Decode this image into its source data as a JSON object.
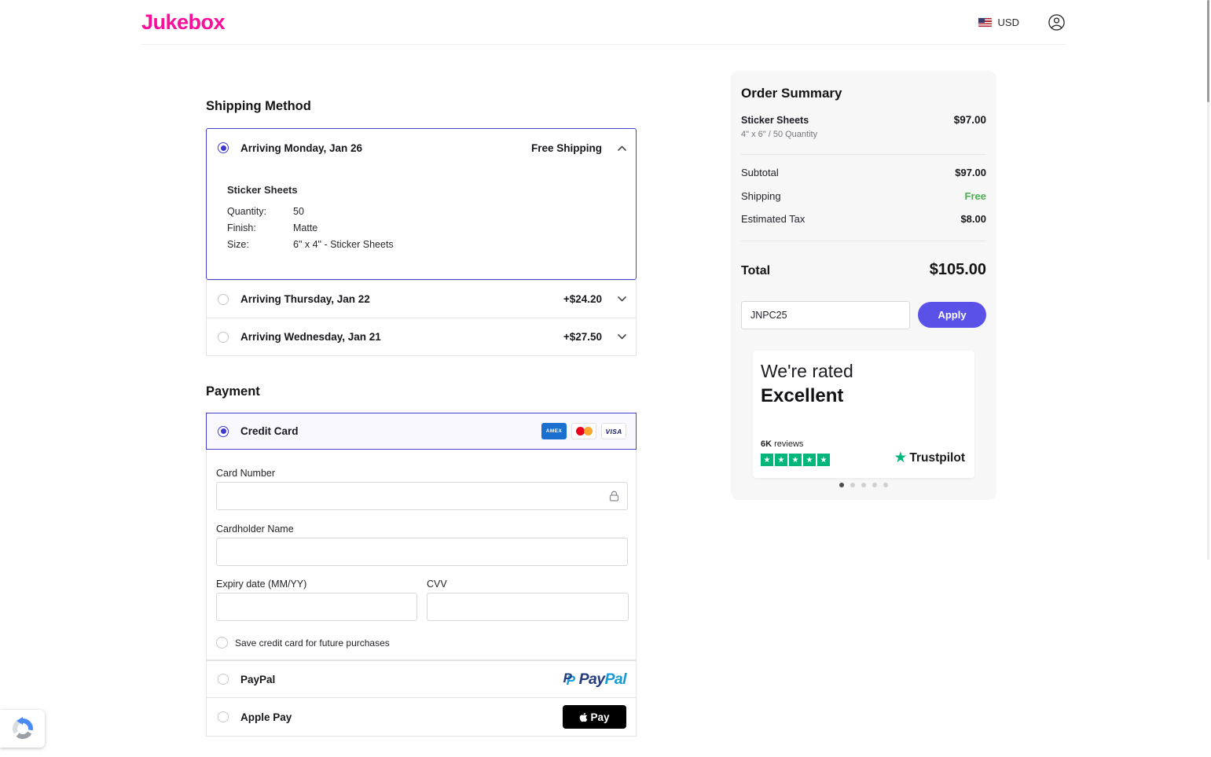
{
  "header": {
    "logo": "Jukebox",
    "currency": "USD"
  },
  "shipping": {
    "title": "Shipping Method",
    "options": [
      {
        "label": "Arriving Monday, Jan 26",
        "price": "Free Shipping"
      },
      {
        "label": "Arriving Thursday, Jan 22",
        "price": "+$24.20"
      },
      {
        "label": "Arriving Wednesday, Jan 21",
        "price": "+$27.50"
      }
    ],
    "selected_index": 0,
    "details": {
      "product": "Sticker Sheets",
      "rows": [
        {
          "label": "Quantity:",
          "value": "50"
        },
        {
          "label": "Finish:",
          "value": "Matte"
        },
        {
          "label": "Size:",
          "value": "6\" x 4\" - Sticker Sheets"
        }
      ]
    }
  },
  "payment": {
    "title": "Payment",
    "credit_card_label": "Credit Card",
    "card_brands": {
      "amex": "AMEX",
      "visa": "VISA"
    },
    "card_number_label": "Card Number",
    "cardholder_label": "Cardholder Name",
    "expiry_label": "Expiry date (MM/YY)",
    "cvv_label": "CVV",
    "save_label": "Save credit card for future purchases",
    "paypal_label": "PayPal",
    "paypal_logo": {
      "pay": "Pay",
      "pal": "Pal",
      "icon_letter": "P"
    },
    "apple_pay_label": "Apple Pay",
    "apple_pay_button": "Pay"
  },
  "summary": {
    "title": "Order Summary",
    "item_name": "Sticker Sheets",
    "item_price": "$97.00",
    "item_desc": "4\" x 6\" / 50 Quantity",
    "rows": [
      {
        "label": "Subtotal",
        "value": "$97.00"
      },
      {
        "label": "Shipping",
        "value": "Free"
      },
      {
        "label": "Estimated Tax",
        "value": "$8.00"
      }
    ],
    "total_label": "Total",
    "total_value": "$105.00",
    "promo_code": "JNPC25",
    "apply_label": "Apply"
  },
  "trustpilot": {
    "rated_line": "We're rated",
    "rating_word": "Excellent",
    "reviews_count": "6K",
    "reviews_word": " reviews",
    "star_glyph": "★",
    "brand": "Trustpilot"
  },
  "carousel": {
    "dot_count": 5,
    "active_index": 0
  },
  "icons": {
    "us-flag-icon": "US flag",
    "user-icon": "account person circle",
    "chevron-up-icon": "collapse",
    "chevron-down-icon": "expand",
    "lock-icon": "secure field",
    "amex-icon": "American Express",
    "mastercard-icon": "Mastercard",
    "visa-icon": "Visa",
    "paypal-icon": "PayPal double P",
    "apple-icon": "Apple logo",
    "recaptcha-icon": "reCAPTCHA"
  },
  "colors": {
    "brand_pink": "#FA0F9A",
    "accent_purple": "#4440D0",
    "apply_button": "#5A51E9",
    "free_green": "#4CAF50",
    "trustpilot_green": "#00B67A",
    "apple_pay_black": "#000000"
  }
}
